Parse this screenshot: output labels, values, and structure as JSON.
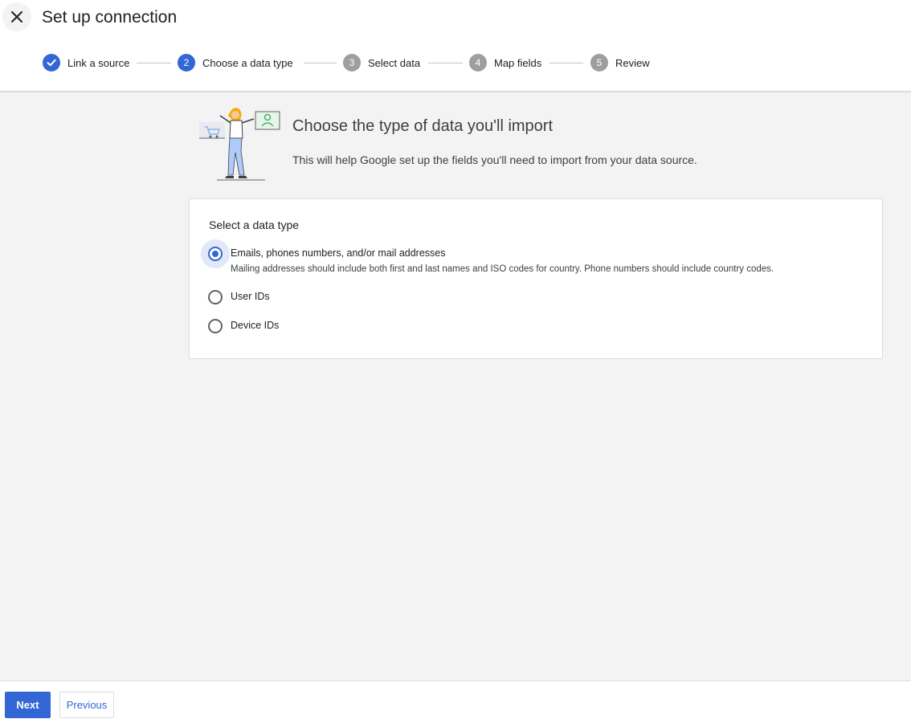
{
  "header": {
    "title": "Set up connection",
    "close_icon": "close-icon"
  },
  "stepper": {
    "steps": [
      {
        "number": "1",
        "label": "Link a source",
        "state": "done"
      },
      {
        "number": "2",
        "label": "Choose a data type",
        "state": "active"
      },
      {
        "number": "3",
        "label": "Select data",
        "state": "pending"
      },
      {
        "number": "4",
        "label": "Map fields",
        "state": "pending"
      },
      {
        "number": "5",
        "label": "Review",
        "state": "pending"
      }
    ]
  },
  "intro": {
    "title": "Choose the type of data you'll import",
    "description": "This will help Google set up the fields you'll need to import from your data source."
  },
  "card": {
    "title": "Select a data type",
    "options": [
      {
        "label": "Emails, phones numbers, and/or mail addresses",
        "help": "Mailing addresses should include both first and last names and ISO codes for country. Phone numbers should include country codes.",
        "selected": true
      },
      {
        "label": "User IDs",
        "selected": false
      },
      {
        "label": "Device IDs",
        "selected": false
      }
    ]
  },
  "footer": {
    "next_label": "Next",
    "previous_label": "Previous"
  },
  "colors": {
    "accent": "#3367d6",
    "pending_step": "#9e9e9e",
    "background": "#f3f3f3"
  }
}
